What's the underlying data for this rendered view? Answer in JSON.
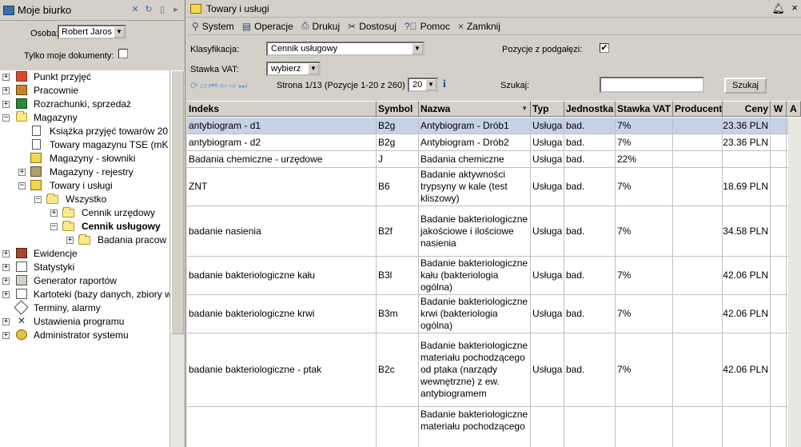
{
  "left": {
    "title": "Moje biurko",
    "osoba_label": "Osoba:",
    "osoba_value": "Robert Jaros",
    "tylko_label": "Tylko moje dokumenty:",
    "tree": [
      {
        "label": "Punkt przyjęć",
        "icon": "reception-icon"
      },
      {
        "label": "Pracownie",
        "icon": "lab-icon"
      },
      {
        "label": "Rozrachunki, sprzedaż",
        "icon": "money-icon"
      },
      {
        "label": "Magazyny",
        "icon": "warehouse-icon"
      },
      {
        "label": "Książka przyjęć towarów 20",
        "icon": "book-icon"
      },
      {
        "label": "Towary magazynu TSE (mK",
        "icon": "document-icon"
      },
      {
        "label": "Magazyny - słowniki",
        "icon": "dictionary-icon"
      },
      {
        "label": "Magazyny - rejestry",
        "icon": "register-icon"
      },
      {
        "label": "Towary i usługi",
        "icon": "goods-icon"
      },
      {
        "label": "Wszystko",
        "icon": "folder-icon"
      },
      {
        "label": "Cennik urzędowy",
        "icon": "folder-icon"
      },
      {
        "label": "Cennik usługowy",
        "icon": "folder-icon"
      },
      {
        "label": "Badania pracow",
        "icon": "folder-icon"
      },
      {
        "label": "Ewidencje",
        "icon": "records-icon"
      },
      {
        "label": "Statystyki",
        "icon": "stats-icon"
      },
      {
        "label": "Generator raportów",
        "icon": "report-icon"
      },
      {
        "label": "Kartoteki (bazy danych, zbiory w",
        "icon": "cards-icon"
      },
      {
        "label": "Terminy, alarmy",
        "icon": "alarm-icon"
      },
      {
        "label": "Ustawienia programu",
        "icon": "settings-icon"
      },
      {
        "label": "Administrator systemu",
        "icon": "admin-icon"
      }
    ]
  },
  "right": {
    "title": "Towary i usługi",
    "menu": {
      "system": "System",
      "operacje": "Operacje",
      "drukuj": "Drukuj",
      "dostosuj": "Dostosuj",
      "pomoc": "Pomoc",
      "zamknij": "Zamknij"
    },
    "filters": {
      "klasyfikacja_label": "Klasyfikacja:",
      "klasyfikacja_value": "Cennik usługowy",
      "pozycje_label": "Pozycje z podgałęzi:",
      "pozycje_checked": "✔",
      "stawka_label": "Stawka VAT:",
      "stawka_value": "wybierz",
      "page_info": "Strona 1/13 (Pozycje 1-20 z 260)",
      "page_size": "20",
      "info_icon": "i",
      "szukaj_label": "Szukaj:",
      "szukaj_button": "Szukaj"
    },
    "columns": [
      "Indeks",
      "Symbol",
      "Nazwa",
      "Typ",
      "Jednostka",
      "Stawka VAT",
      "Producent",
      "Ceny",
      "W",
      "A"
    ],
    "rows": [
      {
        "indeks": "antybiogram - d1",
        "symbol": "B2g",
        "nazwa": "Antybiogram - Drób1",
        "typ": "Usługa",
        "jednostka": "bad.",
        "vat": "7%",
        "producent": "",
        "ceny": "23.36 PLN",
        "w": "",
        "a": true
      },
      {
        "indeks": "antybiogram - d2",
        "symbol": "B2g",
        "nazwa": "Antybiogram - Drób2",
        "typ": "Usługa",
        "jednostka": "bad.",
        "vat": "7%",
        "producent": "",
        "ceny": "23.36 PLN",
        "w": "",
        "a": true
      },
      {
        "indeks": "Badania chemiczne - urzędowe",
        "symbol": "J",
        "nazwa": "Badania chemiczne",
        "typ": "Usługa",
        "jednostka": "bad.",
        "vat": "22%",
        "producent": "",
        "ceny": "",
        "w": "",
        "a": true
      },
      {
        "indeks": "ZNT",
        "symbol": "B6",
        "nazwa": "Badanie aktywności trypsyny w kale (test kliszowy)",
        "typ": "Usługa",
        "jednostka": "bad.",
        "vat": "7%",
        "producent": "",
        "ceny": "18.69 PLN",
        "w": "",
        "a": true
      },
      {
        "indeks": "badanie nasienia",
        "symbol": "B2f",
        "nazwa": "Badanie bakteriologiczne jakościowe i ilościowe nasienia",
        "typ": "Usługa",
        "jednostka": "bad.",
        "vat": "7%",
        "producent": "",
        "ceny": "34.58 PLN",
        "w": "",
        "a": true
      },
      {
        "indeks": "badanie bakteriologiczne kału",
        "symbol": "B3l",
        "nazwa": "Badanie bakteriologiczne kału (bakteriologia ogólna)",
        "typ": "Usługa",
        "jednostka": "bad.",
        "vat": "7%",
        "producent": "",
        "ceny": "42.06 PLN",
        "w": "",
        "a": true
      },
      {
        "indeks": "badanie bakteriologiczne krwi",
        "symbol": "B3m",
        "nazwa": "Badanie bakteriologiczne krwi (bakteriologia ogólna)",
        "typ": "Usługa",
        "jednostka": "bad.",
        "vat": "7%",
        "producent": "",
        "ceny": "42.06 PLN",
        "w": "",
        "a": true
      },
      {
        "indeks": "badanie bakteriologiczne - ptak",
        "symbol": "B2c",
        "nazwa": "Badanie bakteriologiczne materiału pochodzącego od ptaka (narządy wewnętrzne) z ew. antybiogramem",
        "typ": "Usługa",
        "jednostka": "bad.",
        "vat": "7%",
        "producent": "",
        "ceny": "42.06 PLN",
        "w": "",
        "a": true
      },
      {
        "indeks": "",
        "symbol": "",
        "nazwa": "Badanie bakteriologiczne materiału pochodzącego",
        "typ": "",
        "jednostka": "",
        "vat": "",
        "producent": "",
        "ceny": "",
        "w": "",
        "a": false
      }
    ]
  }
}
